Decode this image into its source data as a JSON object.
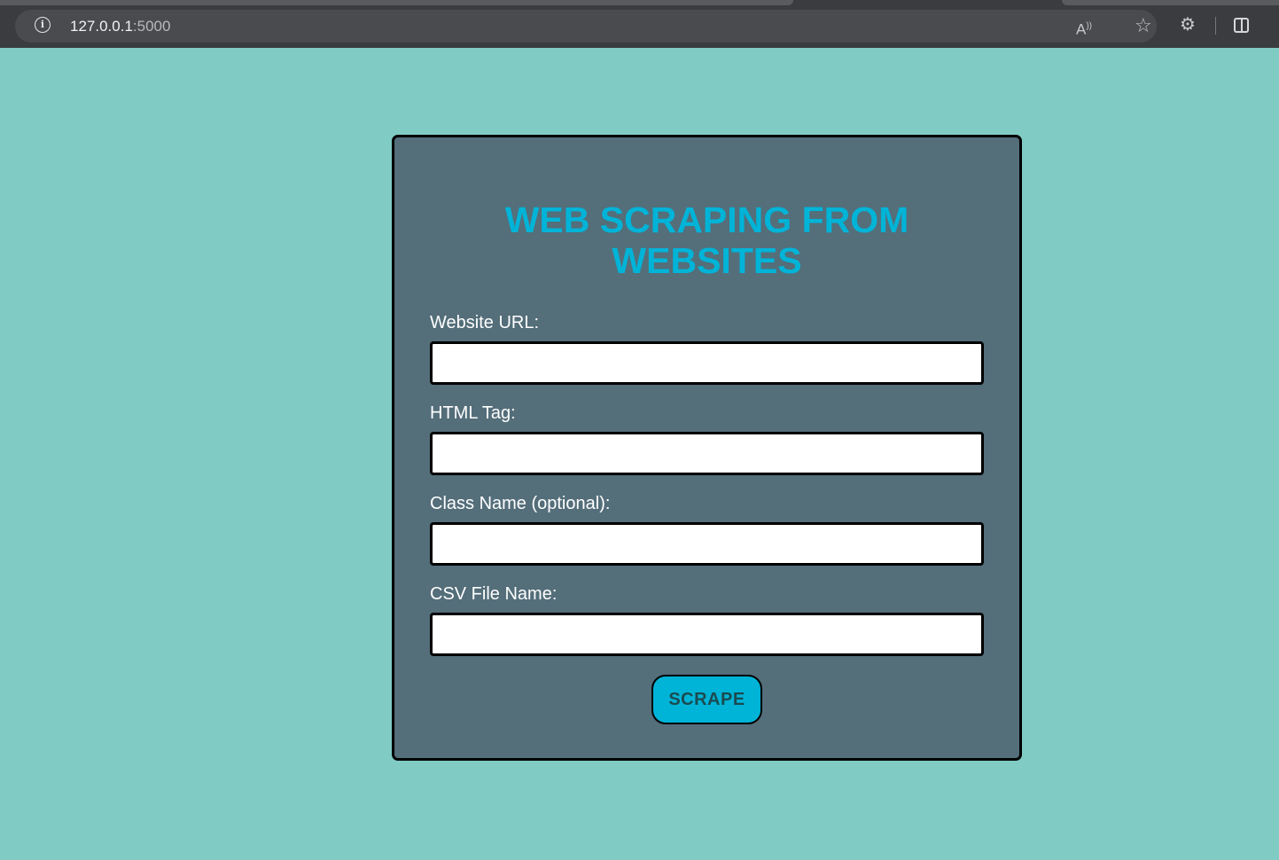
{
  "browser": {
    "url_host": "127.0.0.1",
    "url_port": ":5000",
    "icons": [
      "info-icon",
      "read-aloud-icon",
      "favorite-star-icon",
      "extensions-icon",
      "split-screen-icon"
    ]
  },
  "form": {
    "title_line1": "WEB SCRAPING FROM",
    "title_line2": "WEBSITES",
    "fields": [
      {
        "label": "Website URL:",
        "value": ""
      },
      {
        "label": "HTML Tag:",
        "value": ""
      },
      {
        "label": "Class Name (optional):",
        "value": ""
      },
      {
        "label": "CSV File Name:",
        "value": ""
      }
    ],
    "submit_label": "SCRAPE"
  },
  "colors": {
    "page_background": "#80cbc4",
    "card_background": "#546e7a",
    "accent": "#00b4d8",
    "button_text": "#1b4b50"
  }
}
